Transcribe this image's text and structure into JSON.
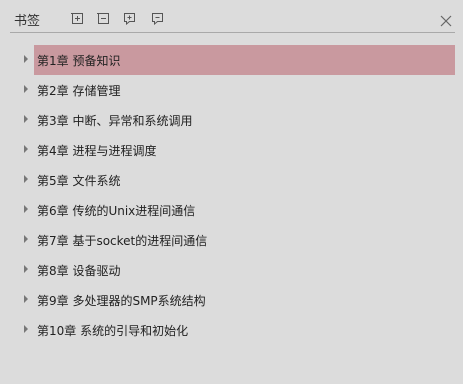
{
  "panel": {
    "title": "书签",
    "toolbar": [
      {
        "name": "add-bookmark-icon"
      },
      {
        "name": "remove-bookmark-icon"
      },
      {
        "name": "add-child-bookmark-icon"
      },
      {
        "name": "edit-bookmark-icon"
      }
    ],
    "close_icon": "close-icon"
  },
  "bookmarks": [
    {
      "label": "第1章 预备知识",
      "selected": true
    },
    {
      "label": "第2章 存储管理",
      "selected": false
    },
    {
      "label": "第3章 中断、异常和系统调用",
      "selected": false
    },
    {
      "label": "第4章 进程与进程调度",
      "selected": false
    },
    {
      "label": "第5章 文件系统",
      "selected": false
    },
    {
      "label": "第6章 传统的Unix进程间通信",
      "selected": false
    },
    {
      "label": "第7章 基于socket的进程间通信",
      "selected": false
    },
    {
      "label": "第8章 设备驱动",
      "selected": false
    },
    {
      "label": "第9章 多处理器的SMP系统结构",
      "selected": false
    },
    {
      "label": "第10章 系统的引导和初始化",
      "selected": false
    }
  ],
  "colors": {
    "background": "#dcdcdc",
    "selected": "#c9999f"
  }
}
